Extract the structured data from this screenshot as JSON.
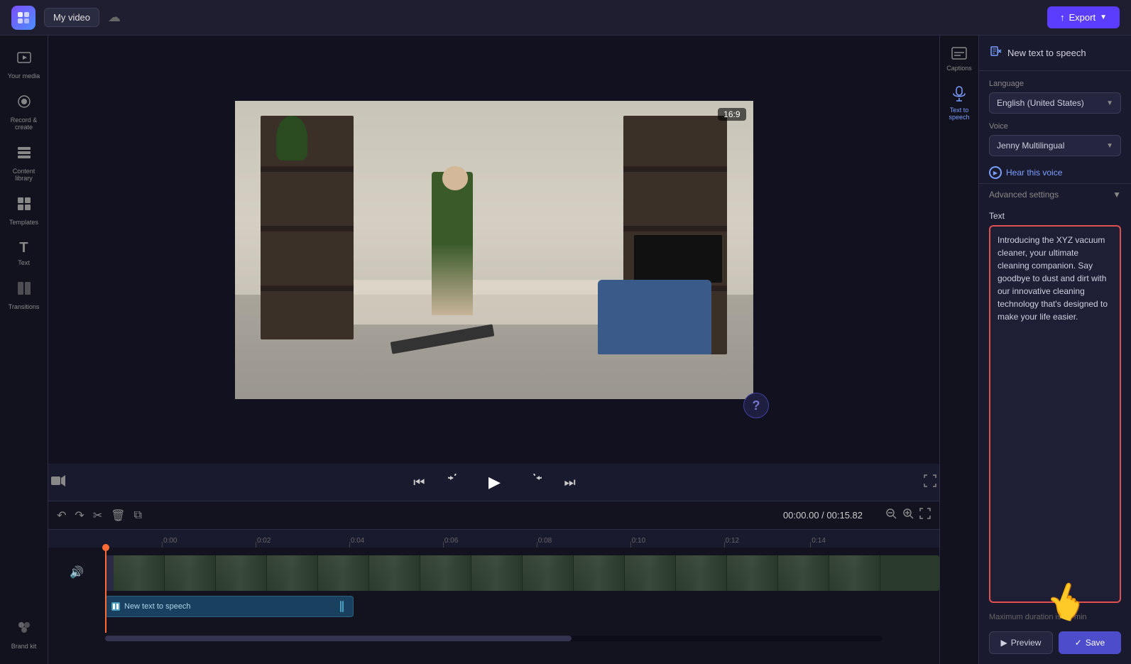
{
  "topbar": {
    "project_name": "My video",
    "export_label": "Export"
  },
  "sidebar": {
    "items": [
      {
        "id": "your-media",
        "icon": "🎬",
        "label": "Your media"
      },
      {
        "id": "record-create",
        "icon": "⏺",
        "label": "Record &\ncreate"
      },
      {
        "id": "content-library",
        "icon": "📚",
        "label": "Content\nlibrary"
      },
      {
        "id": "templates",
        "icon": "⊞",
        "label": "Templates"
      },
      {
        "id": "text",
        "icon": "T",
        "label": "Text"
      },
      {
        "id": "transitions",
        "icon": "⧉",
        "label": "Transitions"
      },
      {
        "id": "brand-kit",
        "icon": "🎨",
        "label": "Brand kit"
      }
    ]
  },
  "video": {
    "aspect_ratio": "16:9",
    "time_current": "00:00.00",
    "time_total": "00:15.82"
  },
  "controls": {
    "skip_back": "⏮",
    "rewind": "↺",
    "play": "▶",
    "forward": "↻",
    "skip_forward": "⏭",
    "camera_icon": "📷",
    "fullscreen": "⛶"
  },
  "timeline": {
    "toolbar": {
      "undo": "↶",
      "redo": "↷",
      "cut": "✂",
      "delete": "🗑",
      "copy": "⧉"
    },
    "time_display": "00:00.00 / 00:15.82",
    "zoom_out": "−",
    "zoom_in": "+",
    "expand": "⛶",
    "ruler_marks": [
      "0:00",
      "0:02",
      "0:04",
      "0:06",
      "0:08",
      "0:10",
      "0:12",
      "0:14"
    ],
    "tts_label": "New text to speech"
  },
  "right_sidebar": {
    "captions_label": "Captions",
    "tts_label": "Text to\nspeech"
  },
  "tts_panel": {
    "header_title": "New text to speech",
    "language_label": "Language",
    "language_value": "English (United States)",
    "voice_label": "Voice",
    "voice_value": "Jenny Multilingual",
    "hear_voice_label": "Hear this voice",
    "advanced_settings_label": "Advanced settings",
    "text_section_label": "Text",
    "text_content": "Introducing the XYZ vacuum cleaner, your ultimate cleaning companion. Say goodbye to dust and dirt with our innovative cleaning technology that's designed to make your life easier.",
    "max_duration_label": "Maximum duration is 10 min",
    "preview_label": "Preview",
    "save_label": "Save"
  }
}
